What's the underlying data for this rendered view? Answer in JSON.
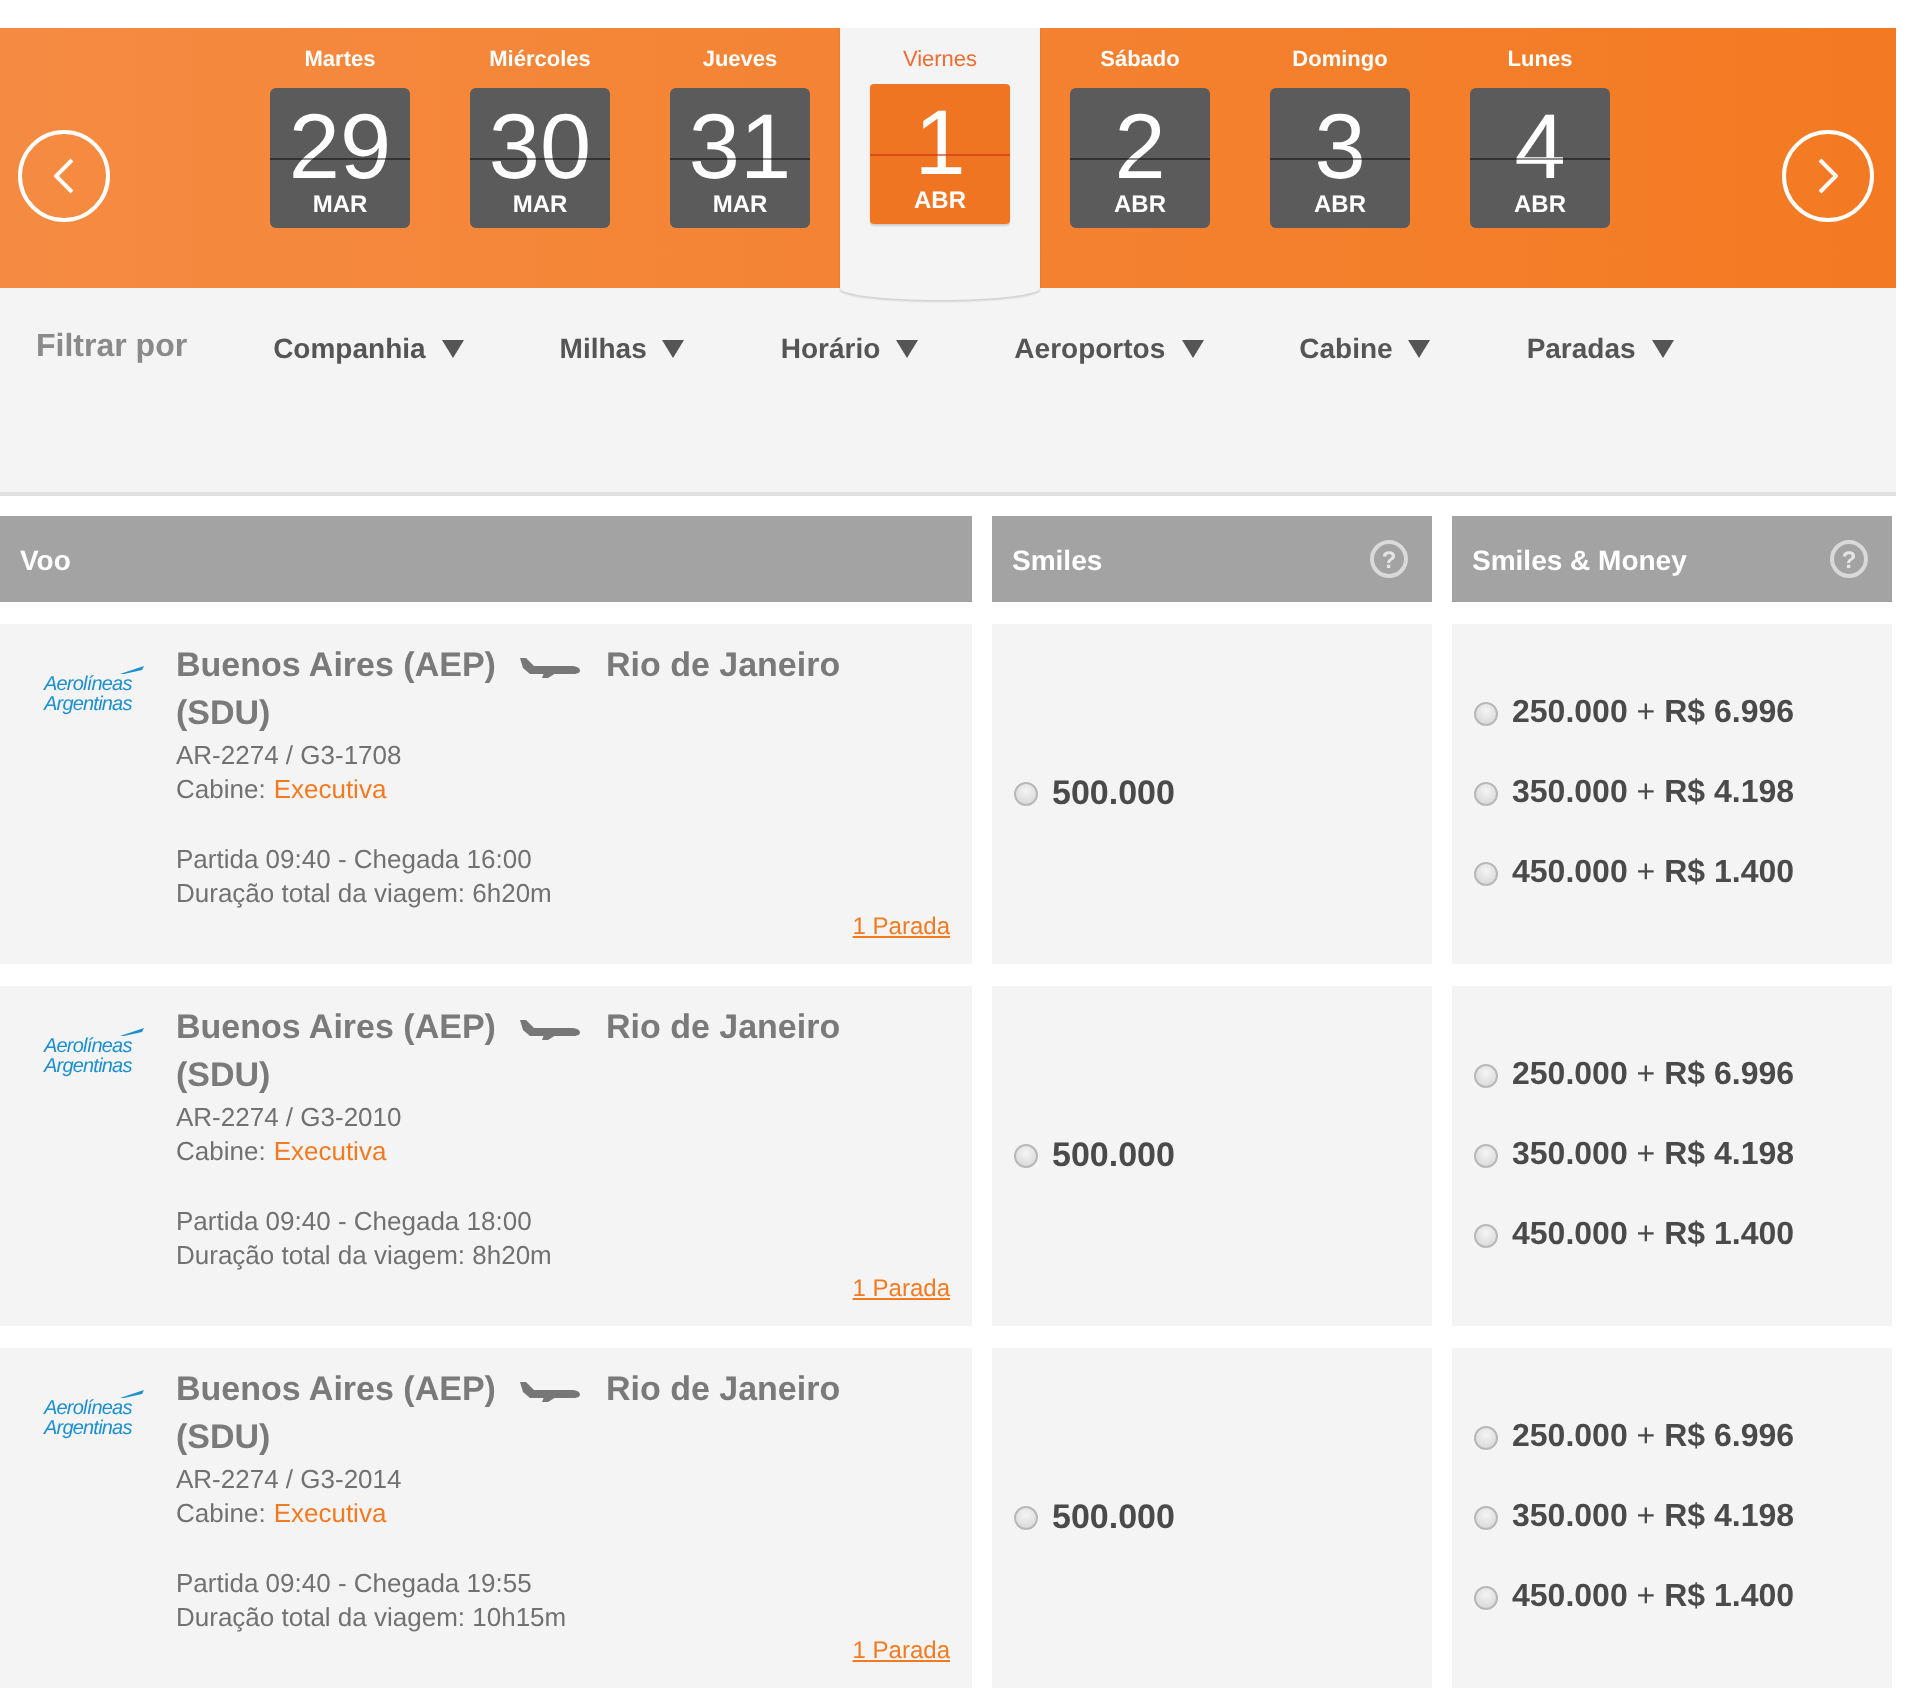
{
  "date_nav": {
    "days": [
      {
        "weekday": "Martes",
        "day": "29",
        "month": "MAR",
        "selected": false
      },
      {
        "weekday": "Miércoles",
        "day": "30",
        "month": "MAR",
        "selected": false
      },
      {
        "weekday": "Jueves",
        "day": "31",
        "month": "MAR",
        "selected": false
      },
      {
        "weekday": "Viernes",
        "day": "1",
        "month": "ABR",
        "selected": true
      },
      {
        "weekday": "Sábado",
        "day": "2",
        "month": "ABR",
        "selected": false
      },
      {
        "weekday": "Domingo",
        "day": "3",
        "month": "ABR",
        "selected": false
      },
      {
        "weekday": "Lunes",
        "day": "4",
        "month": "ABR",
        "selected": false
      }
    ]
  },
  "filters": {
    "label": "Filtrar por",
    "options": [
      "Companhia",
      "Milhas",
      "Horário",
      "Aeroportos",
      "Cabine",
      "Paradas"
    ]
  },
  "table": {
    "columns": [
      {
        "label": "Voo"
      },
      {
        "label": "Smiles",
        "help": "?"
      },
      {
        "label": "Smiles & Money",
        "help": "?"
      }
    ],
    "rows": [
      {
        "airline": "Aerolíneas Argentinas",
        "origin": "Buenos Aires (AEP)",
        "destination": "Rio de Janeiro",
        "destination_code": "(SDU)",
        "flight": "AR-2274 / G3-1708",
        "cabin_label": "Cabine:",
        "cabin": "Executiva",
        "times": "Partida 09:40 - Chegada 16:00",
        "duration": "Duração total da viagem: 6h20m",
        "stops": "1 Parada",
        "smiles": {
          "price": "500.000",
          "selected": false
        },
        "smiles_money": [
          {
            "price": "**250.000** + **R$ 6.996**",
            "selected": false
          },
          {
            "price": "**350.000** + **R$ 4.198**",
            "selected": false
          },
          {
            "price": "**450.000** + **R$ 1.400**",
            "selected": false
          }
        ]
      },
      {
        "airline": "Aerolíneas Argentinas",
        "origin": "Buenos Aires (AEP)",
        "destination": "Rio de Janeiro",
        "destination_code": "(SDU)",
        "flight": "AR-2274 / G3-2010",
        "cabin_label": "Cabine:",
        "cabin": "Executiva",
        "times": "Partida 09:40 - Chegada 18:00",
        "duration": "Duração total da viagem: 8h20m",
        "stops": "1 Parada",
        "smiles": {
          "price": "500.000",
          "selected": false
        },
        "smiles_money": [
          {
            "price": "**250.000** + **R$ 6.996**",
            "selected": false
          },
          {
            "price": "**350.000** + **R$ 4.198**",
            "selected": false
          },
          {
            "price": "**450.000** + **R$ 1.400**",
            "selected": false
          }
        ]
      },
      {
        "airline": "Aerolíneas Argentinas",
        "origin": "Buenos Aires (AEP)",
        "destination": "Rio de Janeiro",
        "destination_code": "(SDU)",
        "flight": "AR-2274 / G3-2014",
        "cabin_label": "Cabine:",
        "cabin": "Executiva",
        "times": "Partida 09:40 - Chegada 19:55",
        "duration": "Duração total da viagem: 10h15m",
        "stops": "1 Parada",
        "smiles": {
          "price": "500.000",
          "selected": false
        },
        "smiles_money": [
          {
            "price": "**250.000** + **R$ 6.996**",
            "selected": false
          },
          {
            "price": "**350.000** + **R$ 4.198**",
            "selected": false
          },
          {
            "price": "**450.000** + **R$ 1.400**",
            "selected": false
          }
        ]
      }
    ]
  }
}
